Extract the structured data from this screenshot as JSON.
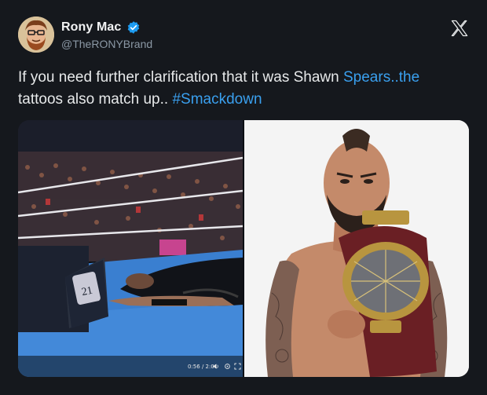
{
  "tweet": {
    "author": {
      "display_name": "Rony Mac",
      "handle": "@TheRONYBrand",
      "verified": true,
      "verified_color": "#1d9bf0"
    },
    "platform_icon": "x-logo-icon",
    "text_parts": {
      "part1": "If you need further clarification that it was Shawn ",
      "link1": "Spears..the",
      "part2": " tattoos also match up.. ",
      "hashtag": "#Smackdown"
    },
    "link_color": "#3aa0ef",
    "media": {
      "left_image": "wrestling-ring-broadcast-still",
      "right_image": "wrestler-holding-championship-belt",
      "video_timestamp": "0:56 / 2:01",
      "player_icons": [
        "volume-icon",
        "settings-icon",
        "fullscreen-icon"
      ]
    }
  },
  "colors": {
    "background": "#15181d",
    "text": "#e7e9ea",
    "secondary_text": "#8b98a5"
  }
}
